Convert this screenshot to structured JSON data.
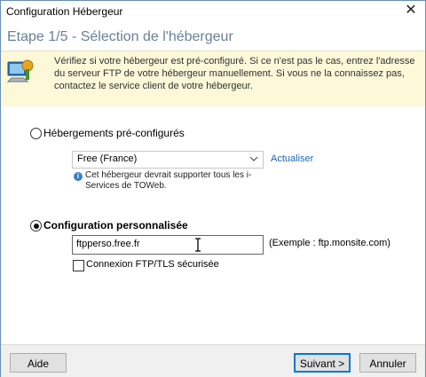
{
  "window": {
    "title": "Configuration Hébergeur"
  },
  "header": {
    "step_title": "Etape 1/5 - Sélection de l'hébergeur"
  },
  "info": {
    "text": "Vérifiez si votre hébergeur est pré-configuré. Si ce n'est pas le cas, entrez l'adresse du serveur FTP de votre hébergeur manuellement. Si vous ne la connaissez pas, contactez le service client de votre hébergeur."
  },
  "preconfigured": {
    "label": "Hébergements pré-configurés",
    "selected": "Free (France)",
    "refresh_link": "Actualiser",
    "note": "Cet hébergeur devrait supporter tous les i-Services de TOWeb."
  },
  "custom": {
    "label": "Configuration personnalisée",
    "server_value": "ftpperso.free.fr",
    "example": "(Exemple : ftp.monsite.com)",
    "tls_label": "Connexion FTP/TLS sécurisée",
    "tls_checked": false
  },
  "footer": {
    "help_label": "Aide",
    "next_label": "Suivant >",
    "cancel_label": "Annuler"
  }
}
